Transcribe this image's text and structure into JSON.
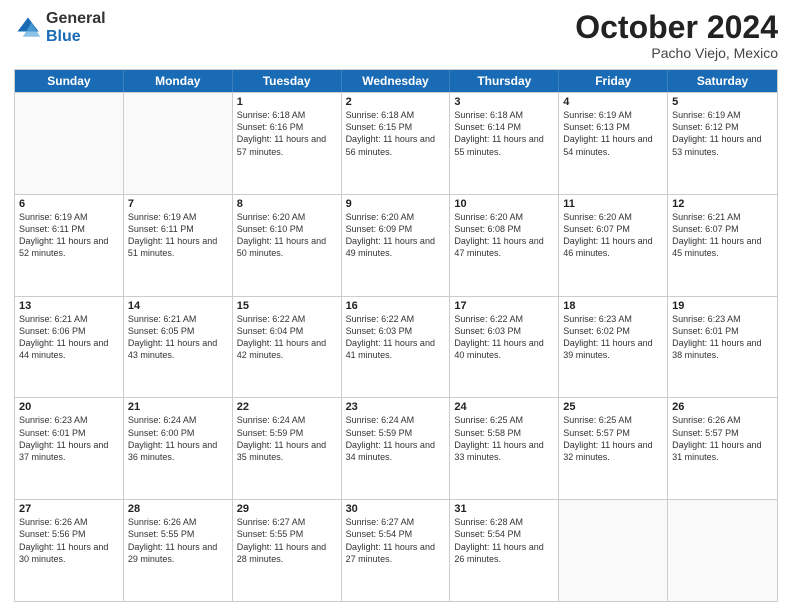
{
  "logo": {
    "general": "General",
    "blue": "Blue"
  },
  "title": {
    "month": "October 2024",
    "location": "Pacho Viejo, Mexico"
  },
  "header_days": [
    "Sunday",
    "Monday",
    "Tuesday",
    "Wednesday",
    "Thursday",
    "Friday",
    "Saturday"
  ],
  "weeks": [
    [
      {
        "day": "",
        "sunrise": "",
        "sunset": "",
        "daylight": ""
      },
      {
        "day": "",
        "sunrise": "",
        "sunset": "",
        "daylight": ""
      },
      {
        "day": "1",
        "sunrise": "Sunrise: 6:18 AM",
        "sunset": "Sunset: 6:16 PM",
        "daylight": "Daylight: 11 hours and 57 minutes."
      },
      {
        "day": "2",
        "sunrise": "Sunrise: 6:18 AM",
        "sunset": "Sunset: 6:15 PM",
        "daylight": "Daylight: 11 hours and 56 minutes."
      },
      {
        "day": "3",
        "sunrise": "Sunrise: 6:18 AM",
        "sunset": "Sunset: 6:14 PM",
        "daylight": "Daylight: 11 hours and 55 minutes."
      },
      {
        "day": "4",
        "sunrise": "Sunrise: 6:19 AM",
        "sunset": "Sunset: 6:13 PM",
        "daylight": "Daylight: 11 hours and 54 minutes."
      },
      {
        "day": "5",
        "sunrise": "Sunrise: 6:19 AM",
        "sunset": "Sunset: 6:12 PM",
        "daylight": "Daylight: 11 hours and 53 minutes."
      }
    ],
    [
      {
        "day": "6",
        "sunrise": "Sunrise: 6:19 AM",
        "sunset": "Sunset: 6:11 PM",
        "daylight": "Daylight: 11 hours and 52 minutes."
      },
      {
        "day": "7",
        "sunrise": "Sunrise: 6:19 AM",
        "sunset": "Sunset: 6:11 PM",
        "daylight": "Daylight: 11 hours and 51 minutes."
      },
      {
        "day": "8",
        "sunrise": "Sunrise: 6:20 AM",
        "sunset": "Sunset: 6:10 PM",
        "daylight": "Daylight: 11 hours and 50 minutes."
      },
      {
        "day": "9",
        "sunrise": "Sunrise: 6:20 AM",
        "sunset": "Sunset: 6:09 PM",
        "daylight": "Daylight: 11 hours and 49 minutes."
      },
      {
        "day": "10",
        "sunrise": "Sunrise: 6:20 AM",
        "sunset": "Sunset: 6:08 PM",
        "daylight": "Daylight: 11 hours and 47 minutes."
      },
      {
        "day": "11",
        "sunrise": "Sunrise: 6:20 AM",
        "sunset": "Sunset: 6:07 PM",
        "daylight": "Daylight: 11 hours and 46 minutes."
      },
      {
        "day": "12",
        "sunrise": "Sunrise: 6:21 AM",
        "sunset": "Sunset: 6:07 PM",
        "daylight": "Daylight: 11 hours and 45 minutes."
      }
    ],
    [
      {
        "day": "13",
        "sunrise": "Sunrise: 6:21 AM",
        "sunset": "Sunset: 6:06 PM",
        "daylight": "Daylight: 11 hours and 44 minutes."
      },
      {
        "day": "14",
        "sunrise": "Sunrise: 6:21 AM",
        "sunset": "Sunset: 6:05 PM",
        "daylight": "Daylight: 11 hours and 43 minutes."
      },
      {
        "day": "15",
        "sunrise": "Sunrise: 6:22 AM",
        "sunset": "Sunset: 6:04 PM",
        "daylight": "Daylight: 11 hours and 42 minutes."
      },
      {
        "day": "16",
        "sunrise": "Sunrise: 6:22 AM",
        "sunset": "Sunset: 6:03 PM",
        "daylight": "Daylight: 11 hours and 41 minutes."
      },
      {
        "day": "17",
        "sunrise": "Sunrise: 6:22 AM",
        "sunset": "Sunset: 6:03 PM",
        "daylight": "Daylight: 11 hours and 40 minutes."
      },
      {
        "day": "18",
        "sunrise": "Sunrise: 6:23 AM",
        "sunset": "Sunset: 6:02 PM",
        "daylight": "Daylight: 11 hours and 39 minutes."
      },
      {
        "day": "19",
        "sunrise": "Sunrise: 6:23 AM",
        "sunset": "Sunset: 6:01 PM",
        "daylight": "Daylight: 11 hours and 38 minutes."
      }
    ],
    [
      {
        "day": "20",
        "sunrise": "Sunrise: 6:23 AM",
        "sunset": "Sunset: 6:01 PM",
        "daylight": "Daylight: 11 hours and 37 minutes."
      },
      {
        "day": "21",
        "sunrise": "Sunrise: 6:24 AM",
        "sunset": "Sunset: 6:00 PM",
        "daylight": "Daylight: 11 hours and 36 minutes."
      },
      {
        "day": "22",
        "sunrise": "Sunrise: 6:24 AM",
        "sunset": "Sunset: 5:59 PM",
        "daylight": "Daylight: 11 hours and 35 minutes."
      },
      {
        "day": "23",
        "sunrise": "Sunrise: 6:24 AM",
        "sunset": "Sunset: 5:59 PM",
        "daylight": "Daylight: 11 hours and 34 minutes."
      },
      {
        "day": "24",
        "sunrise": "Sunrise: 6:25 AM",
        "sunset": "Sunset: 5:58 PM",
        "daylight": "Daylight: 11 hours and 33 minutes."
      },
      {
        "day": "25",
        "sunrise": "Sunrise: 6:25 AM",
        "sunset": "Sunset: 5:57 PM",
        "daylight": "Daylight: 11 hours and 32 minutes."
      },
      {
        "day": "26",
        "sunrise": "Sunrise: 6:26 AM",
        "sunset": "Sunset: 5:57 PM",
        "daylight": "Daylight: 11 hours and 31 minutes."
      }
    ],
    [
      {
        "day": "27",
        "sunrise": "Sunrise: 6:26 AM",
        "sunset": "Sunset: 5:56 PM",
        "daylight": "Daylight: 11 hours and 30 minutes."
      },
      {
        "day": "28",
        "sunrise": "Sunrise: 6:26 AM",
        "sunset": "Sunset: 5:55 PM",
        "daylight": "Daylight: 11 hours and 29 minutes."
      },
      {
        "day": "29",
        "sunrise": "Sunrise: 6:27 AM",
        "sunset": "Sunset: 5:55 PM",
        "daylight": "Daylight: 11 hours and 28 minutes."
      },
      {
        "day": "30",
        "sunrise": "Sunrise: 6:27 AM",
        "sunset": "Sunset: 5:54 PM",
        "daylight": "Daylight: 11 hours and 27 minutes."
      },
      {
        "day": "31",
        "sunrise": "Sunrise: 6:28 AM",
        "sunset": "Sunset: 5:54 PM",
        "daylight": "Daylight: 11 hours and 26 minutes."
      },
      {
        "day": "",
        "sunrise": "",
        "sunset": "",
        "daylight": ""
      },
      {
        "day": "",
        "sunrise": "",
        "sunset": "",
        "daylight": ""
      }
    ]
  ]
}
